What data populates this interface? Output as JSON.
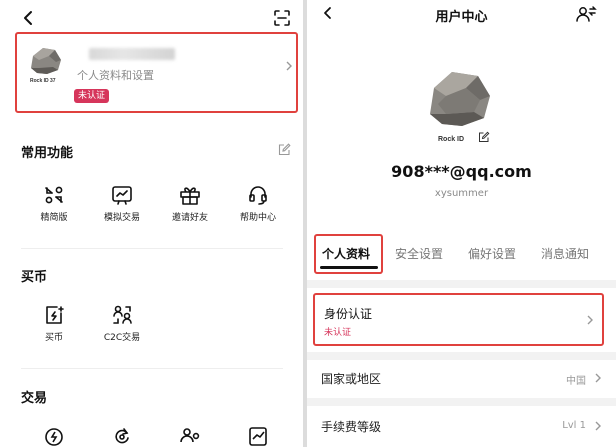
{
  "left": {
    "profile": {
      "subtitle": "个人资料和设置",
      "status_badge": "未认证",
      "avatar_caption": "Rock ID 37"
    },
    "sections": [
      {
        "title": "常用功能",
        "items": [
          {
            "label": "精简版",
            "icon": "compact-icon"
          },
          {
            "label": "模拟交易",
            "icon": "demo-trade-icon"
          },
          {
            "label": "邀请好友",
            "icon": "gift-icon"
          },
          {
            "label": "帮助中心",
            "icon": "headset-icon"
          }
        ]
      },
      {
        "title": "买币",
        "items": [
          {
            "label": "买币",
            "icon": "buy-coin-icon"
          },
          {
            "label": "C2C交易",
            "icon": "c2c-icon"
          }
        ]
      },
      {
        "title": "交易",
        "items": [
          {
            "label": "",
            "icon": "flash-icon"
          },
          {
            "label": "",
            "icon": "convert-icon"
          },
          {
            "label": "",
            "icon": "copy-trade-icon"
          },
          {
            "label": "",
            "icon": "chart-icon"
          }
        ]
      }
    ]
  },
  "right": {
    "title": "用户中心",
    "avatar_caption": "Rock ID",
    "email": "908***@qq.com",
    "username": "xysummer",
    "tabs": [
      "个人资料",
      "安全设置",
      "偏好设置",
      "消息通知"
    ],
    "identity": {
      "label": "身份认证",
      "status": "未认证"
    },
    "rows": [
      {
        "label": "国家或地区",
        "value": "中国"
      },
      {
        "label": "手续费等级",
        "value": "Lvl 1"
      }
    ]
  },
  "colors": {
    "highlight": "#e0413e",
    "badge": "#d6355b"
  }
}
